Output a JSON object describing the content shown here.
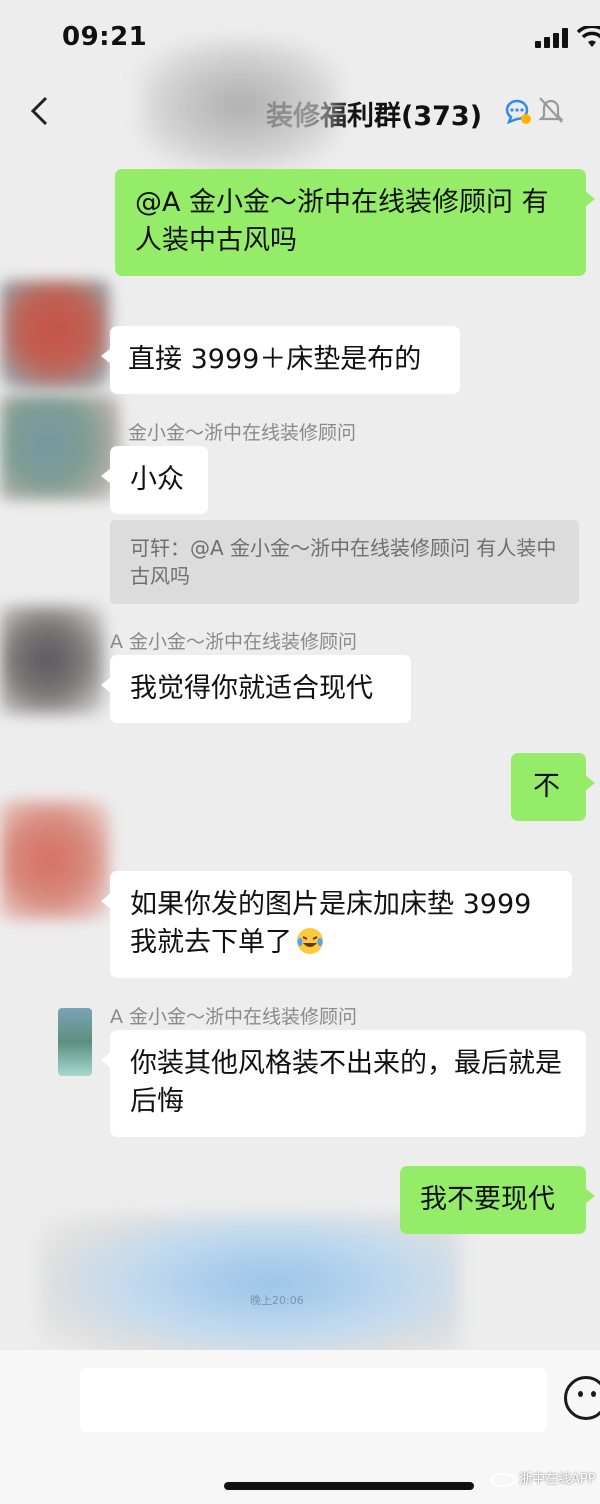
{
  "status_bar": {
    "time": "09:21"
  },
  "nav": {
    "title": "装修福利群(373)"
  },
  "messages": {
    "m1": {
      "text": "@A 金小金～浙中在线装修顾问 有人装中古风吗"
    },
    "m2": {
      "text": "直接 3999＋床垫是布的"
    },
    "m3": {
      "sender": "金小金～浙中在线装修顾问",
      "text": "小众"
    },
    "m3_quote": {
      "text": "可轩：@A 金小金～浙中在线装修顾问 有人装中古风吗"
    },
    "m4": {
      "sender": "A 金小金～浙中在线装修顾问",
      "text": "我觉得你就适合现代"
    },
    "m5": {
      "text": "不"
    },
    "m6": {
      "text": "如果你发的图片是床加床垫 3999 我就去下单了"
    },
    "m7": {
      "sender": "A 金小金～浙中在线装修顾问",
      "text": "你装其他风格装不出来的，最后就是后悔"
    },
    "m8": {
      "text": "我不要现代"
    }
  },
  "timestamp_hint": "晚上20:06",
  "watermark": "浙中在线APP",
  "colors": {
    "own_bubble": "#95ec69",
    "other_bubble": "#ffffff",
    "background": "#ededed"
  }
}
